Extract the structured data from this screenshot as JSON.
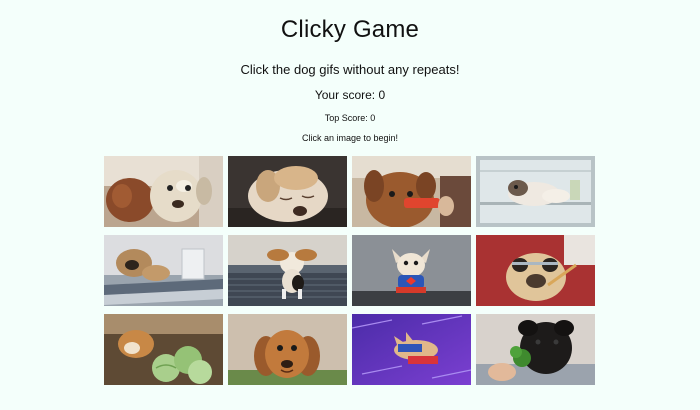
{
  "header": {
    "title": "Clicky Game",
    "subtitle": "Click the dog gifs without any repeats!",
    "score": "Your score: 0",
    "top_score": "Top Score: 0",
    "message": "Click an image to begin!"
  },
  "grid": {
    "tiles": [
      {
        "icon": "two-dogs-close-up"
      },
      {
        "icon": "sleepy-puppy"
      },
      {
        "icon": "dog-with-treat"
      },
      {
        "icon": "dog-in-fridge"
      },
      {
        "icon": "pug-on-bed"
      },
      {
        "icon": "beagle-puppy-jumping"
      },
      {
        "icon": "chihuahua-superman"
      },
      {
        "icon": "pug-with-sunglasses"
      },
      {
        "icon": "corgi-with-cabbage"
      },
      {
        "icon": "dachshund-face"
      },
      {
        "icon": "chihuahua-flying"
      },
      {
        "icon": "black-pug-broccoli"
      }
    ]
  }
}
